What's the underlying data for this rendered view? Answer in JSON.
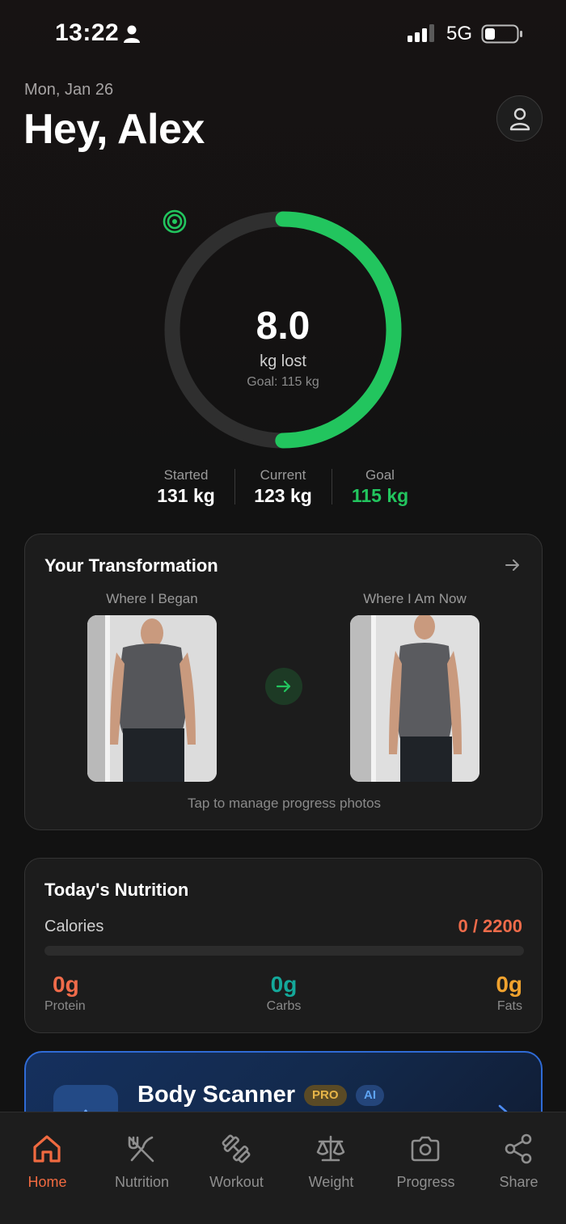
{
  "status_bar": {
    "time": "13:22",
    "network": "5G",
    "icons": [
      "person-icon",
      "signal-icon",
      "battery-icon"
    ]
  },
  "header": {
    "date": "Mon, Jan 26",
    "greeting": "Hey, Alex",
    "profile_icon": "person-outline-icon"
  },
  "progress_ring": {
    "value": "8.0",
    "unit": "kg lost",
    "goal_text": "Goal: 115 kg",
    "progress_fraction": 0.5,
    "accent_color": "#22c55e"
  },
  "stats": [
    {
      "label": "Started",
      "value": "131 kg"
    },
    {
      "label": "Current",
      "value": "123 kg"
    },
    {
      "label": "Goal",
      "value": "115 kg"
    }
  ],
  "transformation": {
    "title": "Your Transformation",
    "before_label": "Where I Began",
    "after_label": "Where I Am Now",
    "manage_text": "Tap to manage progress photos"
  },
  "nutrition": {
    "title": "Today's Nutrition",
    "calories_label": "Calories",
    "calories_value": "0 / 2200",
    "calories_fraction": 0,
    "macros": [
      {
        "value": "0g",
        "label": "Protein",
        "color": "#ef6b4a"
      },
      {
        "value": "0g",
        "label": "Carbs",
        "color": "#14a89a"
      },
      {
        "value": "0g",
        "label": "Fats",
        "color": "#f0a22e"
      }
    ]
  },
  "scanner": {
    "title": "Body Scanner",
    "badge_pro": "PRO",
    "badge_ai": "AI"
  },
  "tabs": [
    {
      "label": "Home",
      "icon": "home-icon",
      "active": true
    },
    {
      "label": "Nutrition",
      "icon": "utensils-icon",
      "active": false
    },
    {
      "label": "Workout",
      "icon": "dumbbell-icon",
      "active": false
    },
    {
      "label": "Weight",
      "icon": "scale-icon",
      "active": false
    },
    {
      "label": "Progress",
      "icon": "camera-icon",
      "active": false
    },
    {
      "label": "Share",
      "icon": "share-icon",
      "active": false
    }
  ]
}
